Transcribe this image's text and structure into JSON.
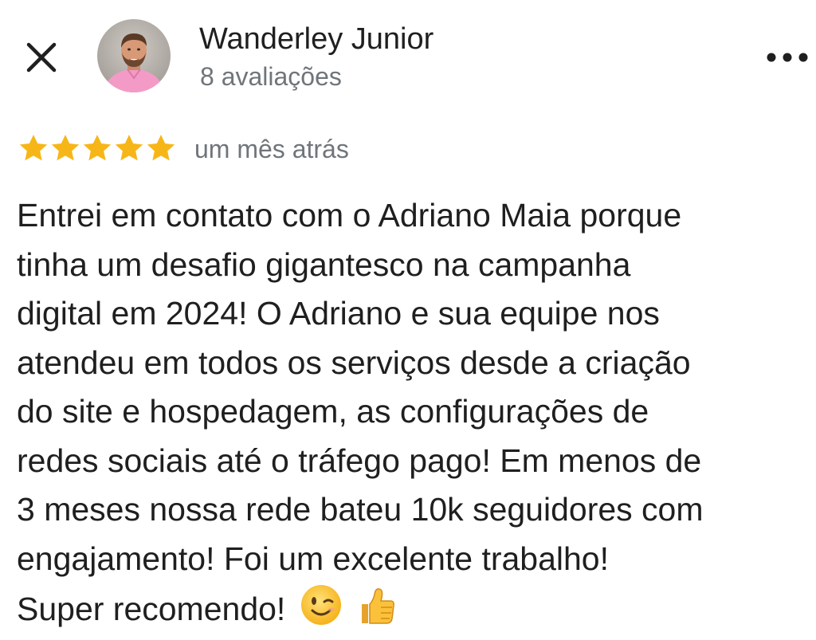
{
  "header": {
    "close_icon": "close-icon",
    "author_name": "Wanderley Junior",
    "review_count": "8 avaliações",
    "more_icon": "more-horizontal-icon"
  },
  "review": {
    "rating": 5,
    "rating_max": 5,
    "time_ago": "um mês atrás",
    "text": "Entrei em contato com o Adriano Maia porque\ntinha um desafio gigantesco na campanha\ndigital em 2024! O Adriano e sua equipe nos\natendeu em todos os serviços desde a criação\ndo site e hospedagem, as configurações de\nredes sociais até o tráfego pago! Em menos de\n3 meses nossa rede bateu 10k seguidores com\nengajamento! Foi um excelente trabalho!\nSuper recomendo!",
    "emojis": [
      "winking-face-emoji",
      "thumbs-up-emoji"
    ]
  },
  "colors": {
    "star": "#f7b618",
    "secondary_text": "#70757a",
    "primary_text": "#1f1f1f",
    "avatar_bg": "#b9b3ad",
    "shirt": "#f39bc6"
  }
}
